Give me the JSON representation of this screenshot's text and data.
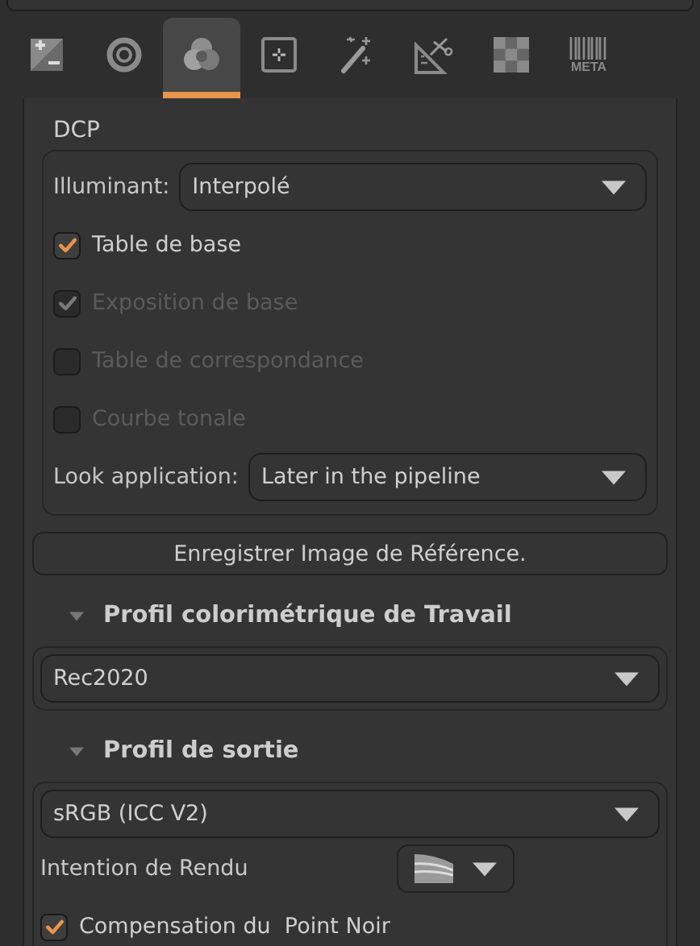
{
  "tabs": [
    {
      "selected": false
    },
    {
      "selected": false
    },
    {
      "selected": true
    },
    {
      "selected": false
    },
    {
      "selected": false
    },
    {
      "selected": false
    },
    {
      "selected": false
    },
    {
      "label": "META",
      "selected": false
    }
  ],
  "dcp": {
    "title": "DCP",
    "illuminant": {
      "label": "Illuminant:",
      "value": "Interpolé"
    },
    "options": [
      {
        "label": "Table de base",
        "checked": true,
        "disabled": false
      },
      {
        "label": "Exposition de base",
        "checked": true,
        "disabled": true
      },
      {
        "label": "Table de correspondance",
        "checked": false,
        "disabled": true
      },
      {
        "label": "Courbe tonale",
        "checked": false,
        "disabled": true
      }
    ],
    "look": {
      "label": "Look application:",
      "value": "Later in the pipeline"
    }
  },
  "save_button": "Enregistrer Image de Référence.",
  "working_profile": {
    "title": "Profil colorimétrique de Travail",
    "expanded": true,
    "value": "Rec2020"
  },
  "output_profile": {
    "title": "Profil de sortie",
    "expanded": true,
    "value": "sRGB (ICC V2)",
    "intent_label": "Intention de Rendu",
    "black_point": {
      "label": "Compensation du  Point Noir",
      "checked": true
    }
  }
}
